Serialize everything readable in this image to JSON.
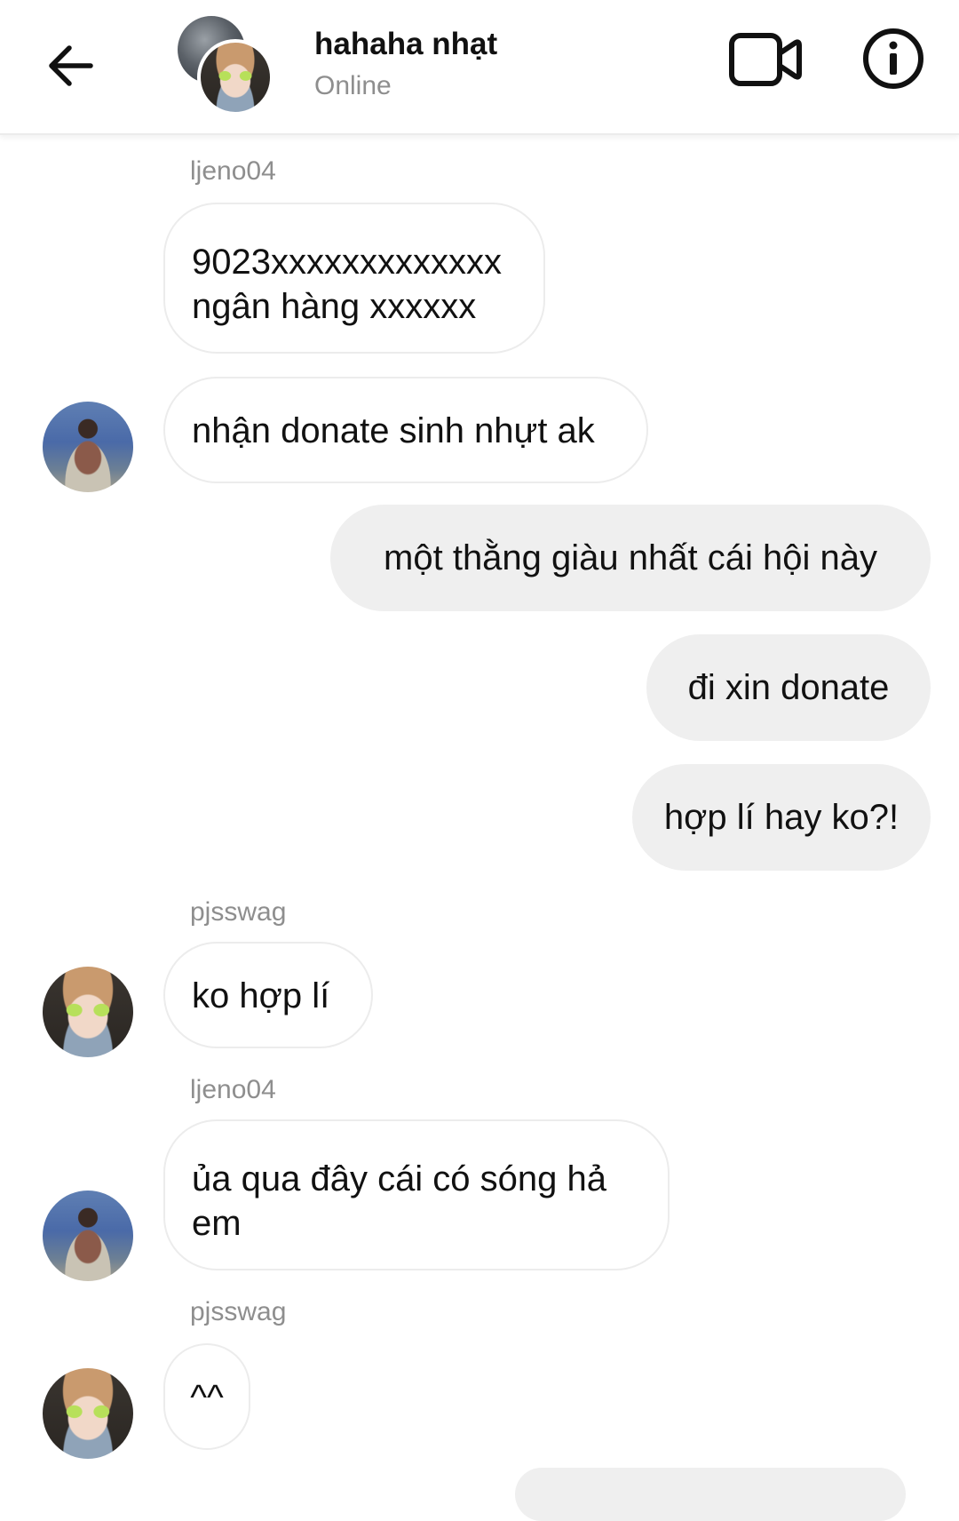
{
  "header": {
    "title": "hahaha nhạt",
    "status": "Online"
  },
  "messages": [
    {
      "sender": "ljeno04",
      "text_line1": "9023xxxxxxxxxxxxx",
      "text_line2": "ngân hàng xxxxxx"
    },
    {
      "text": "nhận donate sinh nhựt ak"
    },
    {
      "text": "một thằng giàu nhất cái hội này"
    },
    {
      "text": "đi xin donate"
    },
    {
      "text": "hợp lí hay ko?!"
    },
    {
      "sender": "pjsswag",
      "text": "ko hợp lí"
    },
    {
      "sender": "ljeno04",
      "text_line1": "ủa qua đây cái có sóng hả",
      "text_line2": "em"
    },
    {
      "sender": "pjsswag",
      "text": "^^"
    }
  ],
  "colors": {
    "bubble_outgoing": "#efefef",
    "bubble_border": "#ececec",
    "secondary_text": "#8e8e8e"
  },
  "icons": [
    "back-arrow-icon",
    "video-camera-icon",
    "info-icon"
  ]
}
